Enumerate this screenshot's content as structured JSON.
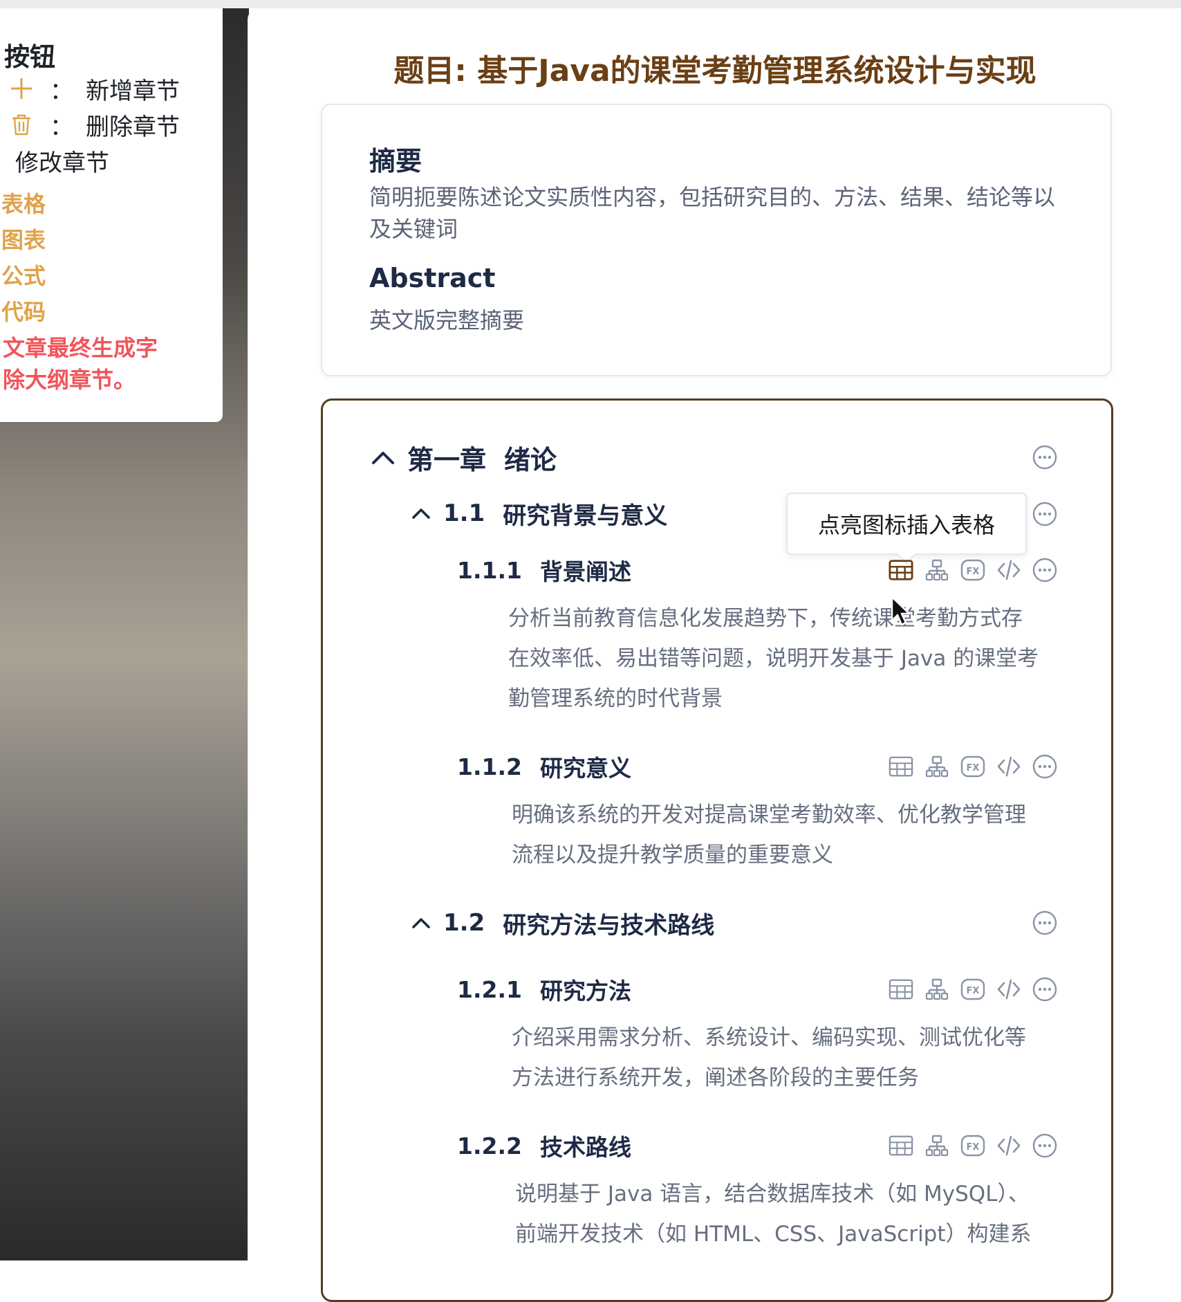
{
  "legend": {
    "title": "按钮",
    "items": [
      {
        "icon": "plus-icon",
        "colon": "：",
        "label": "新增章节"
      },
      {
        "icon": "trash-icon",
        "colon": "：",
        "label": "删除章节"
      }
    ],
    "edit_label": "修改章节",
    "orange_items": [
      "表格",
      "图表",
      "公式",
      "代码"
    ],
    "red_lines": [
      "文章最终生成字",
      "除大纲章节。"
    ]
  },
  "page": {
    "title": "题目: 基于Java的课堂考勤管理系统设计与实现"
  },
  "abstract": {
    "cn_heading": "摘要",
    "cn_text": "简明扼要陈述论文实质性内容，包括研究目的、方法、结果、结论等以及关键词",
    "en_heading": "Abstract",
    "en_text": "英文版完整摘要"
  },
  "outline": {
    "tooltip": "点亮图标插入表格",
    "chapter": {
      "number": "第一章",
      "title": "绪论"
    },
    "sections": [
      {
        "number": "1.1",
        "title": "研究背景与意义",
        "subsections": [
          {
            "number": "1.1.1",
            "title": "背景阐述",
            "text": "分析当前教育信息化发展趋势下，传统课堂考勤方式存在效率低、易出错等问题，说明开发基于 Java 的课堂考勤管理系统的时代背景"
          },
          {
            "number": "1.1.2",
            "title": "研究意义",
            "text": "明确该系统的开发对提高课堂考勤效率、优化教学管理流程以及提升教学质量的重要意义"
          }
        ]
      },
      {
        "number": "1.2",
        "title": "研究方法与技术路线",
        "subsections": [
          {
            "number": "1.2.1",
            "title": "研究方法",
            "text": "介绍采用需求分析、系统设计、编码实现、测试优化等方法进行系统开发，阐述各阶段的主要任务"
          },
          {
            "number": "1.2.2",
            "title": "技术路线",
            "text": "说明基于 Java 语言，结合数据库技术（如 MySQL）、前端开发技术（如 HTML、CSS、JavaScript）构建系"
          }
        ]
      }
    ]
  },
  "colors": {
    "title_brown": "#6a3f14",
    "heading_navy": "#1e2a45",
    "body_gray": "#666e80",
    "legend_orange": "#e0a24a",
    "legend_red": "#f1545a",
    "icon_gray": "#8a93a6",
    "icon_active": "#6a3f14",
    "outline_border": "#563b22"
  }
}
